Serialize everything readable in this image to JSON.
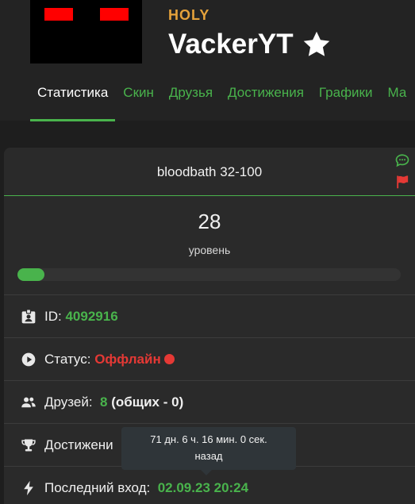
{
  "player": {
    "rank": "HOLY",
    "name": "VackerYT"
  },
  "tabs": [
    {
      "label": "Статистика"
    },
    {
      "label": "Скин"
    },
    {
      "label": "Друзья"
    },
    {
      "label": "Достижения"
    },
    {
      "label": "Графики"
    },
    {
      "label": "Ма"
    }
  ],
  "stats": {
    "server": "bloodbath 32-100",
    "level_value": "28",
    "level_label": "уровень",
    "level_progress": 0.07,
    "id_label": "ID:",
    "id_value": "4092916",
    "status_label": "Статус:",
    "status_value": "Оффлайн",
    "friends_label": "Друзей:",
    "friends_value": "8",
    "friends_common": "(общих - 0)",
    "achievements_label": "Достижени",
    "last_login_label": "Последний вход:",
    "last_login_value": "02.09.23 20:24"
  },
  "tooltip": {
    "line1": "71 дн. 6 ч. 16 мин. 0 сек.",
    "line2": "назад"
  },
  "colors": {
    "accent": "#49b34c",
    "rank": "#e5a23b",
    "offline": "#e53935",
    "background": "#1e1e1e"
  },
  "icons": [
    "star-icon",
    "comment-icon",
    "flag-icon",
    "id-badge-icon",
    "play-icon",
    "users-icon",
    "trophy-icon",
    "bolt-icon"
  ]
}
